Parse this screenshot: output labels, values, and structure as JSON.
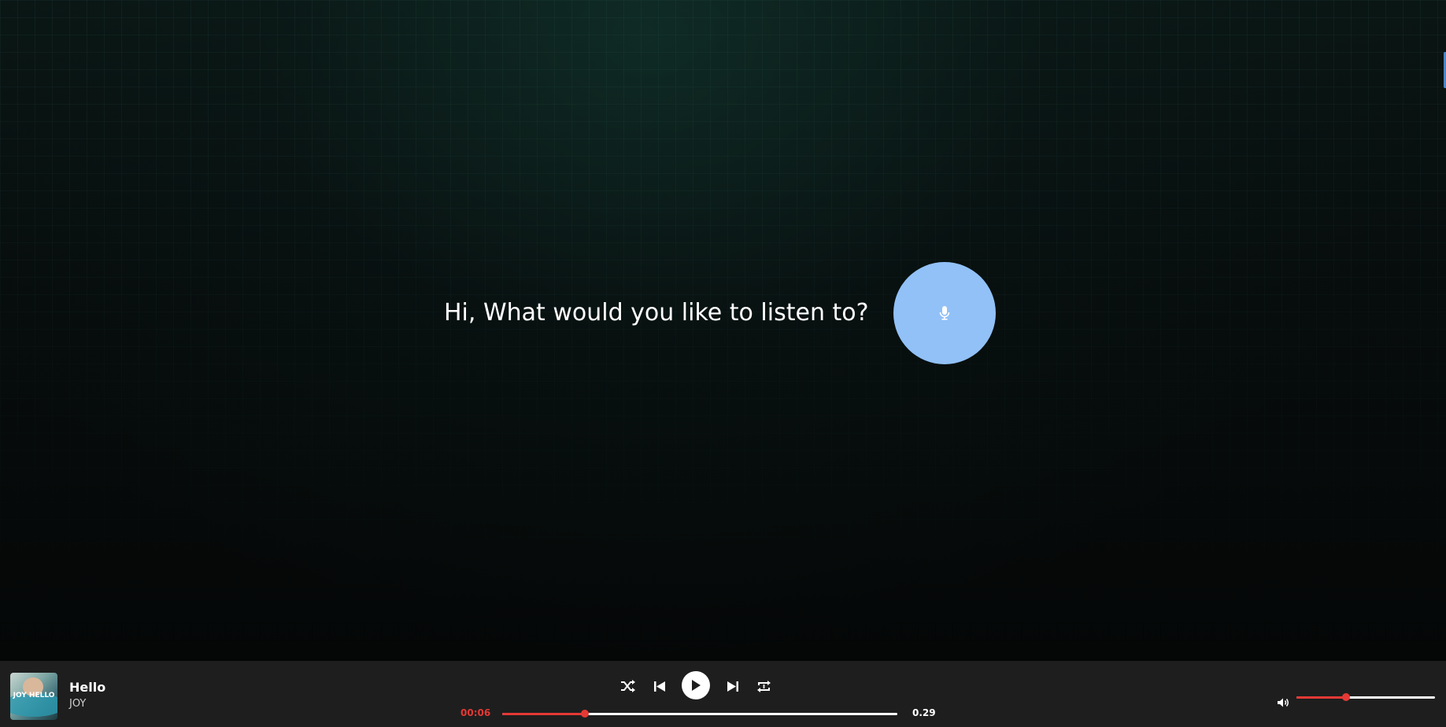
{
  "main": {
    "prompt": "Hi, What would you like to listen to?",
    "mic_icon": "microphone-icon",
    "mic_color": "#91c1f7"
  },
  "player": {
    "cover": {
      "text": "JOY HELLO"
    },
    "track": {
      "title": "Hello",
      "artist": "JOY"
    },
    "controls": {
      "shuffle_icon": "shuffle-icon",
      "previous_icon": "skip-previous-icon",
      "play_icon": "play-icon",
      "next_icon": "skip-next-icon",
      "repeat_icon": "repeat-one-icon"
    },
    "time_current": "00:06",
    "time_total": "0.29",
    "progress_fraction": 0.21,
    "volume_icon": "volume-icon",
    "volume_fraction": 0.36,
    "accent_color": "#e53935",
    "bar_color": "#1e1e1e"
  }
}
